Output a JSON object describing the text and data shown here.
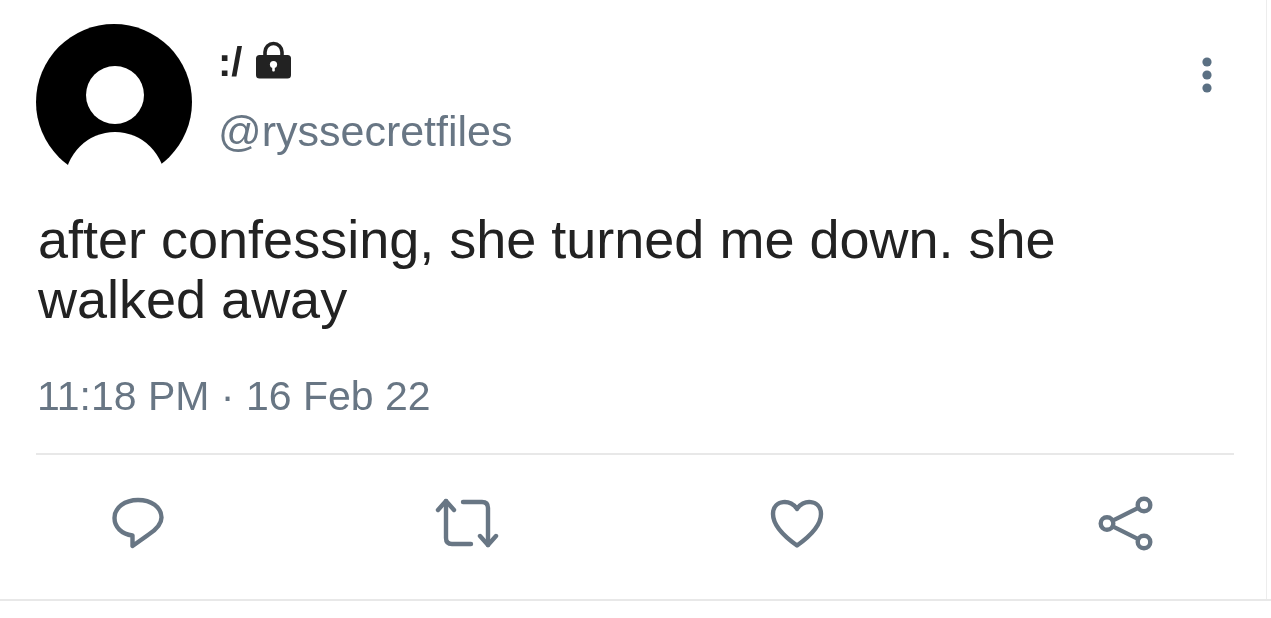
{
  "author": {
    "name": ":/",
    "protected": true,
    "handle": "@ryssecretfiles"
  },
  "tweet": {
    "text": "after confessing, she turned me down. she walked away",
    "timestamp": "11:18 PM · 16 Feb 22"
  },
  "actions": [
    {
      "kind": "reply"
    },
    {
      "kind": "retweet"
    },
    {
      "kind": "like"
    },
    {
      "kind": "share"
    }
  ]
}
